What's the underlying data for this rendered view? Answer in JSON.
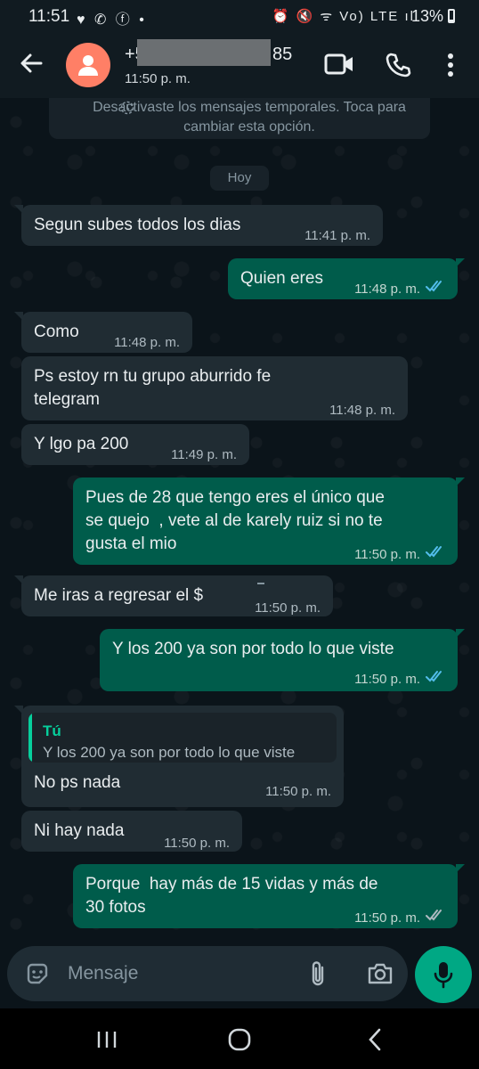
{
  "status_bar": {
    "time": "11:51",
    "left_icons": "♥ ✆ ⓕ •",
    "right_icons": "⏰ 🔇 ᯤ Vo) LTE ıl",
    "battery": "13%"
  },
  "header": {
    "contact_prefix": "+5",
    "contact_suffix": "85",
    "contact_status": "11:50 p. m."
  },
  "system_notice": "Desactivaste los mensajes temporales. Toca para cambiar esta opción.",
  "day_label": "Hoy",
  "messages": [
    {
      "dir": "in",
      "text": "Segun subes todos los dias",
      "time": "11:41 p. m."
    },
    {
      "dir": "out",
      "text": "Quien eres",
      "time": "11:48 p. m.",
      "status": "read"
    },
    {
      "dir": "in",
      "text": "Como",
      "time": "11:48 p. m."
    },
    {
      "dir": "in",
      "text": "Ps estoy rn tu grupo aburrido fe\ntelegram",
      "time": "11:48 p. m."
    },
    {
      "dir": "in",
      "text": "Y lgo pa 200",
      "time": "11:49 p. m."
    },
    {
      "dir": "out",
      "text": "Pues de 28 que tengo eres el único que\nse quejo  , vete al de karely ruiz si no te\ngusta el mio",
      "time": "11:50 p. m.",
      "status": "read"
    },
    {
      "dir": "in",
      "text": "Me iras a regresar el $",
      "time": "11:50 p. m."
    },
    {
      "dir": "out",
      "text": "Y los 200 ya son por todo lo que viste",
      "time": "11:50 p. m.",
      "status": "read"
    },
    {
      "dir": "in",
      "text": "No ps nada",
      "time": "11:50 p. m.",
      "quote_author": "Tú",
      "quote_text": "Y los 200 ya son por todo lo que viste"
    },
    {
      "dir": "in",
      "text": "Ni hay nada",
      "time": "11:50 p. m."
    },
    {
      "dir": "out",
      "text": "Porque  hay más de 15 vidas y más de\n30 fotos",
      "time": "11:50 p. m.",
      "status": "delivered"
    }
  ],
  "input": {
    "placeholder": "Mensaje"
  },
  "colors": {
    "incoming_bubble": "#202c33",
    "outgoing_bubble": "#005c4b",
    "accent": "#00a884",
    "read_ticks": "#53bdeb",
    "delivered_ticks": "#aebac1"
  },
  "icons": [
    "back-arrow-icon",
    "avatar-person-icon",
    "video-call-icon",
    "phone-call-icon",
    "more-options-icon",
    "sticker-icon",
    "attach-icon",
    "camera-icon",
    "mic-icon",
    "recent-apps-icon",
    "home-icon",
    "back-nav-icon"
  ]
}
